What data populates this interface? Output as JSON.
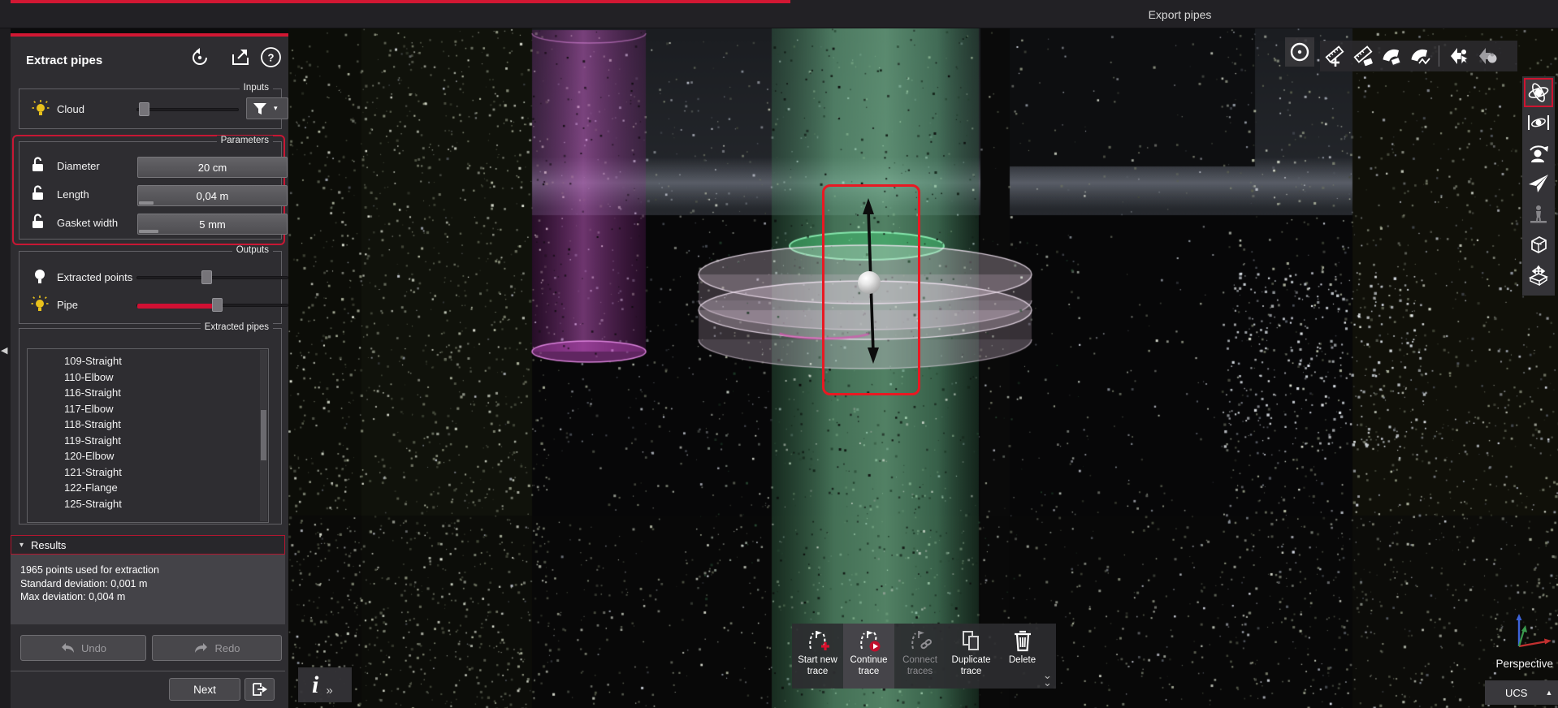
{
  "tab_bar": {
    "active_tab": "Extract pipes",
    "inactive_tab": "Export pipes"
  },
  "panel": {
    "title": "Extract pipes",
    "help_glyph": "?",
    "inputs": {
      "legend": "Inputs",
      "cloud_label": "Cloud"
    },
    "parameters": {
      "legend": "Parameters",
      "rows": [
        {
          "label": "Diameter",
          "value": "20 cm"
        },
        {
          "label": "Length",
          "value": "0,04 m"
        },
        {
          "label": "Gasket width",
          "value": "5 mm"
        }
      ]
    },
    "outputs": {
      "legend": "Outputs",
      "extracted_points_label": "Extracted points",
      "pipe_label": "Pipe"
    },
    "extracted_pipes": {
      "legend": "Extracted pipes",
      "items": [
        "109-Straight",
        "110-Elbow",
        "116-Straight",
        "117-Elbow",
        "118-Straight",
        "119-Straight",
        "120-Elbow",
        "121-Straight",
        "122-Flange",
        "125-Straight"
      ]
    },
    "results": {
      "chevron": "▾",
      "header": "Results",
      "lines": [
        "1965 points used for extraction",
        "Standard deviation: 0,001 m",
        "Max deviation: 0,004 m"
      ]
    },
    "undo_label": "Undo",
    "redo_label": "Redo",
    "next_label": "Next",
    "filter_caret": "▾"
  },
  "rail": {
    "collapse_glyph": "◀"
  },
  "viewport": {
    "info_glyph": "i",
    "info_expand_glyph": "»",
    "trace_toolbar": {
      "buttons": [
        {
          "line1": "Start new",
          "line2": "trace"
        },
        {
          "line1": "Continue",
          "line2": "trace"
        },
        {
          "line1": "Connect",
          "line2": "traces"
        },
        {
          "line1": "Duplicate",
          "line2": "trace"
        },
        {
          "line1": "Delete",
          "line2": ""
        }
      ],
      "collapse_glyph_top": "⌄",
      "collapse_glyph_bottom": "⌄"
    },
    "projection_label": "Perspective",
    "ucs_label": "UCS",
    "ucs_caret": "▲"
  },
  "colors": {
    "accent_red": "#d21733",
    "selection_red": "#ea1822",
    "slider_fill_red": "#d01033",
    "panel_bg": "#2e2d31",
    "pipe_green": "#74c494",
    "pipe_magenta": "#d764d7",
    "gasket_pink": "#e6cbe0",
    "bulb_yellow": "#e8c11c"
  }
}
